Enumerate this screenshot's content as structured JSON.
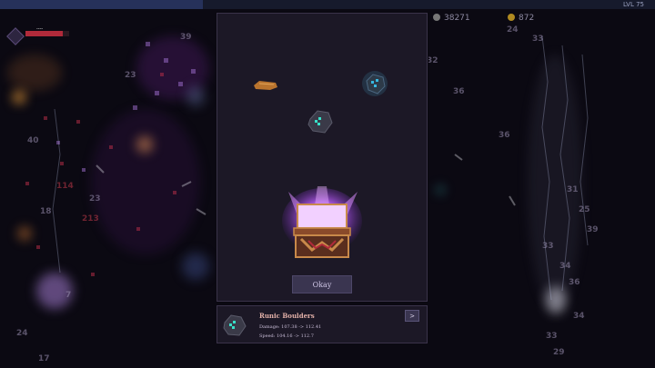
{
  "hud": {
    "xp_progress": 0.31,
    "level_label": "LVL 75",
    "hp_progress": 0.85,
    "hp_text": "----",
    "skull_count": "38271",
    "coin_count": "872"
  },
  "background_numbers": {
    "left": [
      "23",
      "23",
      "18",
      "24",
      "17",
      "39",
      "40",
      "7",
      "114",
      "213"
    ],
    "right": [
      "32",
      "36",
      "36",
      "24",
      "33",
      "31",
      "33",
      "33",
      "29",
      "34",
      "25",
      "34",
      "36",
      "39"
    ]
  },
  "modal": {
    "ok_label": "Okay"
  },
  "item": {
    "name": "Runic Boulders",
    "damage_line": "Damage: 107.38 -> 112.41",
    "speed_line": "Speed: 104.16 -> 112.7",
    "next_symbol": ">"
  },
  "colors": {
    "chest_glow": "#c060ff",
    "item_title": "#e2b0a8",
    "rune_cyan": "#37e0c8"
  },
  "icons": [
    "skull-icon",
    "coin-icon",
    "chest-icon",
    "boulder-icon",
    "blue-rune-stone-icon",
    "bone-icon"
  ]
}
